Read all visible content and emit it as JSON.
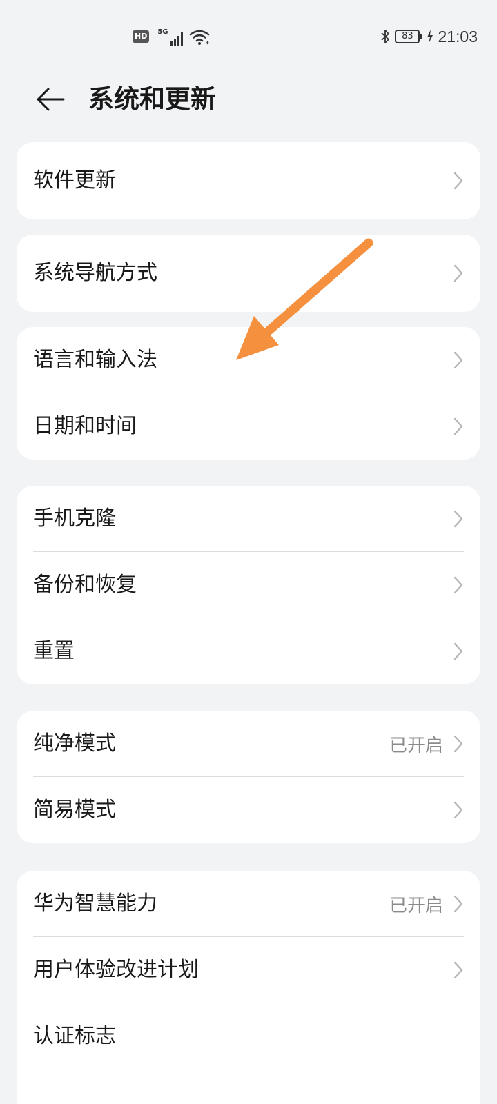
{
  "status_bar": {
    "hd": "HD",
    "network": "5G",
    "battery": "83",
    "time": "21:03"
  },
  "header": {
    "title": "系统和更新"
  },
  "groups": [
    {
      "items": [
        {
          "label": "软件更新",
          "value": ""
        }
      ]
    },
    {
      "items": [
        {
          "label": "系统导航方式",
          "value": ""
        }
      ]
    },
    {
      "items": [
        {
          "label": "语言和输入法",
          "value": ""
        },
        {
          "label": "日期和时间",
          "value": ""
        }
      ]
    },
    {
      "items": [
        {
          "label": "手机克隆",
          "value": ""
        },
        {
          "label": "备份和恢复",
          "value": ""
        },
        {
          "label": "重置",
          "value": ""
        }
      ]
    },
    {
      "items": [
        {
          "label": "纯净模式",
          "value": "已开启"
        },
        {
          "label": "简易模式",
          "value": ""
        }
      ]
    },
    {
      "items": [
        {
          "label": "华为智慧能力",
          "value": "已开启"
        },
        {
          "label": "用户体验改进计划",
          "value": ""
        },
        {
          "label": "认证标志",
          "value": ""
        }
      ]
    }
  ],
  "colors": {
    "background": "#f1f3f5",
    "card": "#ffffff",
    "annotation_arrow": "#f5913e"
  }
}
